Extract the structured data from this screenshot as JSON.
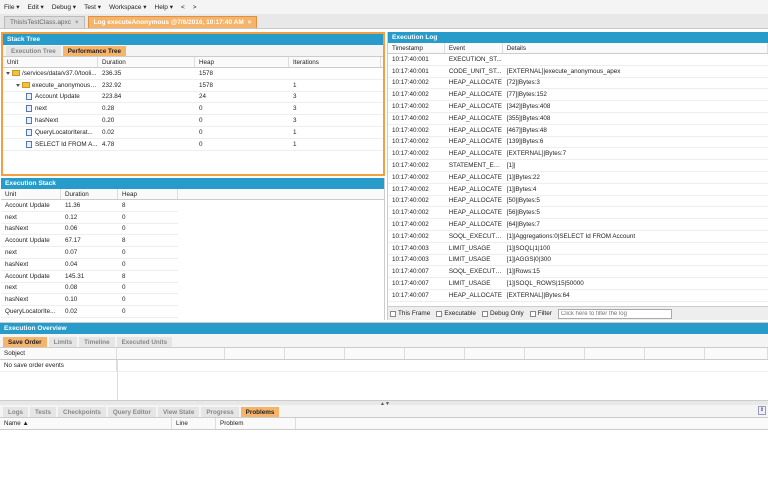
{
  "menu": [
    "File ▾",
    "Edit ▾",
    "Debug ▾",
    "Test ▾",
    "Workspace ▾",
    "Help ▾",
    "<",
    ">"
  ],
  "file_tabs": [
    {
      "label": "ThisIsTestClass.apxc",
      "active": false
    },
    {
      "label": "Log executeAnonymous @7/6/2016, 10:17:40 AM",
      "active": true
    }
  ],
  "stack_tree": {
    "title": "Stack Tree",
    "tabs": [
      "Execution Tree",
      "Performance Tree"
    ],
    "active_tab": 1,
    "columns": [
      "Unit",
      "Duration",
      "Heap",
      "Iterations"
    ],
    "rows": [
      {
        "unit": "/services/data/v37.0/tooli...",
        "duration": "236.35",
        "heap": "1578",
        "iterations": "",
        "level": 0,
        "icon": "folder"
      },
      {
        "unit": "execute_anonymous_...",
        "duration": "232.92",
        "heap": "1578",
        "iterations": "1",
        "level": 1,
        "icon": "folder"
      },
      {
        "unit": "Account Update",
        "duration": "223.84",
        "heap": "24",
        "iterations": "3",
        "level": 2,
        "icon": "doc"
      },
      {
        "unit": "next",
        "duration": "0.28",
        "heap": "0",
        "iterations": "3",
        "level": 2,
        "icon": "doc"
      },
      {
        "unit": "hasNext",
        "duration": "0.20",
        "heap": "0",
        "iterations": "3",
        "level": 2,
        "icon": "doc"
      },
      {
        "unit": "QueryLocatorIterat...",
        "duration": "0.02",
        "heap": "0",
        "iterations": "1",
        "level": 2,
        "icon": "doc"
      },
      {
        "unit": "SELECT Id FROM A...",
        "duration": "4.78",
        "heap": "0",
        "iterations": "1",
        "level": 2,
        "icon": "doc"
      }
    ]
  },
  "execution_stack": {
    "title": "Execution Stack",
    "columns": [
      "Unit",
      "Duration",
      "Heap"
    ],
    "rows": [
      [
        "Account Update",
        "11.36",
        "8"
      ],
      [
        "next",
        "0.12",
        "0"
      ],
      [
        "hasNext",
        "0.06",
        "0"
      ],
      [
        "Account Update",
        "67.17",
        "8"
      ],
      [
        "next",
        "0.07",
        "0"
      ],
      [
        "hasNext",
        "0.04",
        "0"
      ],
      [
        "Account Update",
        "145.31",
        "8"
      ],
      [
        "next",
        "0.08",
        "0"
      ],
      [
        "hasNext",
        "0.10",
        "0"
      ],
      [
        "QueryLocatorIte...",
        "0.02",
        "0"
      ]
    ]
  },
  "execution_log": {
    "title": "Execution Log",
    "columns": [
      "Timestamp",
      "Event",
      "Details"
    ],
    "rows": [
      [
        "10:17:40:001",
        "EXECUTION_ST...",
        ""
      ],
      [
        "10:17:40:001",
        "CODE_UNIT_ST...",
        "[EXTERNAL]|execute_anonymous_apex"
      ],
      [
        "10:17:40:002",
        "HEAP_ALLOCATE",
        "[72]|Bytes:3"
      ],
      [
        "10:17:40:002",
        "HEAP_ALLOCATE",
        "[77]|Bytes:152"
      ],
      [
        "10:17:40:002",
        "HEAP_ALLOCATE",
        "[342]|Bytes:408"
      ],
      [
        "10:17:40:002",
        "HEAP_ALLOCATE",
        "[355]|Bytes:408"
      ],
      [
        "10:17:40:002",
        "HEAP_ALLOCATE",
        "[467]|Bytes:48"
      ],
      [
        "10:17:40:002",
        "HEAP_ALLOCATE",
        "[139]|Bytes:6"
      ],
      [
        "10:17:40:002",
        "HEAP_ALLOCATE",
        "[EXTERNAL]|Bytes:7"
      ],
      [
        "10:17:40:002",
        "STATEMENT_EX...",
        "[1]|"
      ],
      [
        "10:17:40:002",
        "HEAP_ALLOCATE",
        "[1]|Bytes:22"
      ],
      [
        "10:17:40:002",
        "HEAP_ALLOCATE",
        "[1]|Bytes:4"
      ],
      [
        "10:17:40:002",
        "HEAP_ALLOCATE",
        "[50]|Bytes:5"
      ],
      [
        "10:17:40:002",
        "HEAP_ALLOCATE",
        "[56]|Bytes:5"
      ],
      [
        "10:17:40:002",
        "HEAP_ALLOCATE",
        "[64]|Bytes:7"
      ],
      [
        "10:17:40:002",
        "SOQL_EXECUTE...",
        "[1]|Aggregations:0|SELECT Id FROM Account"
      ],
      [
        "10:17:40:003",
        "LIMIT_USAGE",
        "[1]|SOQL|1|100"
      ],
      [
        "10:17:40:003",
        "LIMIT_USAGE",
        "[1]|AGGS|0|300"
      ],
      [
        "10:17:40:007",
        "SOQL_EXECUTE...",
        "[1]|Rows:15"
      ],
      [
        "10:17:40:007",
        "LIMIT_USAGE",
        "[1]|SOQL_ROWS|15|50000"
      ],
      [
        "10:17:40:007",
        "HEAP_ALLOCATE",
        "[EXTERNAL]|Bytes:64"
      ]
    ],
    "filters": [
      "This Frame",
      "Executable",
      "Debug Only",
      "Filter"
    ],
    "filter_placeholder": "Click here to filter the log"
  },
  "execution_overview": {
    "title": "Execution Overview",
    "tabs": [
      "Save Order",
      "Limits",
      "Timeline",
      "Executed Units"
    ],
    "active_tab": 0,
    "column": "Sobject",
    "empty": "No save order events"
  },
  "bottom": {
    "tabs": [
      "Logs",
      "Tests",
      "Checkpoints",
      "Query Editor",
      "View State",
      "Progress",
      "Problems"
    ],
    "active_tab": 6,
    "columns": [
      "Name ▲",
      "Line",
      "Problem"
    ]
  }
}
